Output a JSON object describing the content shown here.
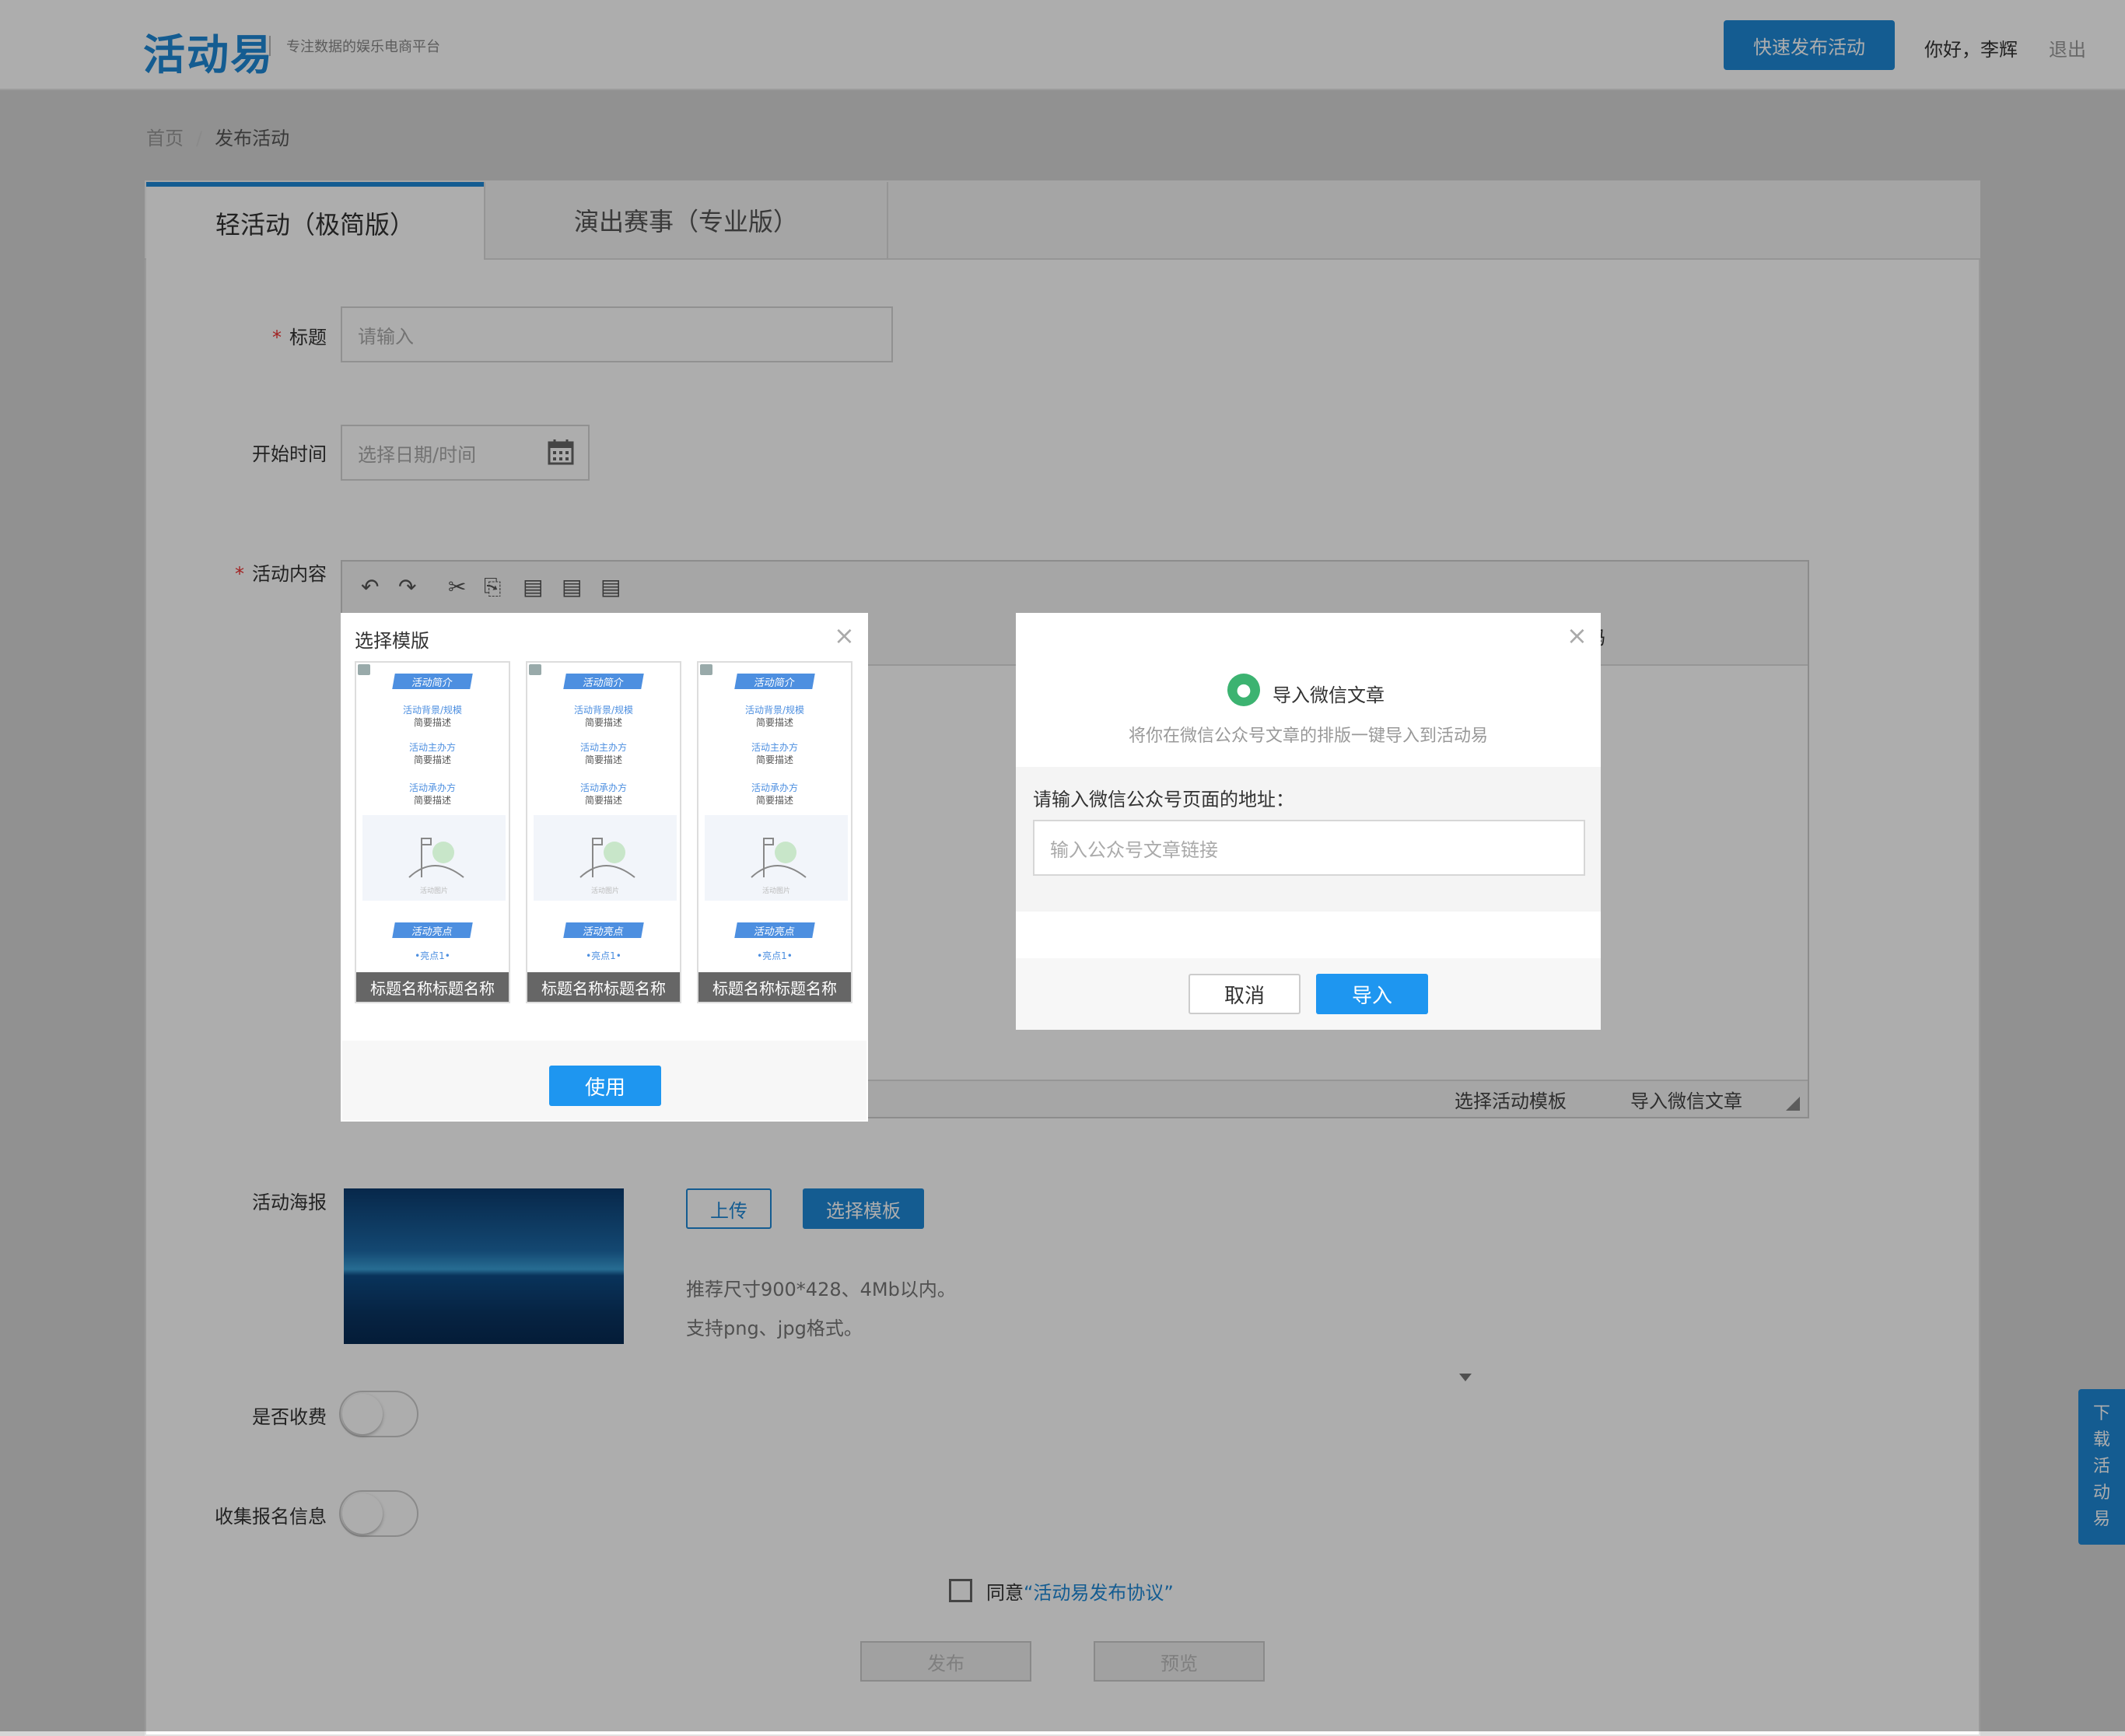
{
  "header": {
    "logo": "活动易",
    "tagline": "专注数据的娱乐电商平台",
    "quick_publish": "快速发布活动",
    "greeting": "你好，李辉",
    "logout": "退出"
  },
  "breadcrumb": {
    "home": "首页",
    "sep": "/",
    "current": "发布活动"
  },
  "tabs": {
    "light": "轻活动（极简版）",
    "pro": "演出赛事（专业版）"
  },
  "form": {
    "required_mark": "*",
    "title_label": "标题",
    "title_placeholder": "请输入",
    "start_label": "开始时间",
    "start_placeholder": "选择日期/时间",
    "content_label": "活动内容",
    "editor_fragment": "码",
    "editor_status": {
      "select_template": "选择活动模板",
      "import_wechat": "导入微信文章"
    },
    "poster_label": "活动海报",
    "upload": "上传",
    "choose_template": "选择模板",
    "hint_size": "推荐尺寸900*428、4Mb以内。",
    "hint_format": "支持png、jpg格式。",
    "fee_label": "是否收费",
    "collect_label": "收集报名信息",
    "agree_prefix": "同意",
    "agree_link": "“活动易发布协议”",
    "publish": "发布",
    "preview": "预览"
  },
  "side_download": [
    "下",
    "载",
    "活",
    "动",
    "易"
  ],
  "template_dialog": {
    "title": "选择模版",
    "close": "×",
    "use": "使用",
    "card": {
      "intro": "活动简介",
      "background": "活动背景/规模",
      "brief": "简要描述",
      "host": "活动主办方",
      "organizer": "活动承办方",
      "image": "活动图片",
      "highlights": "活动亮点",
      "highlight_item": "•亮点1•",
      "caption": "标题名称标题名称"
    }
  },
  "wechat_dialog": {
    "close": "×",
    "title": "导入微信文章",
    "subtitle": "将你在微信公众号文章的排版一键导入到活动易",
    "prompt": "请输入微信公众号页面的地址：",
    "placeholder": "输入公众号文章链接",
    "cancel": "取消",
    "import": "导入"
  }
}
